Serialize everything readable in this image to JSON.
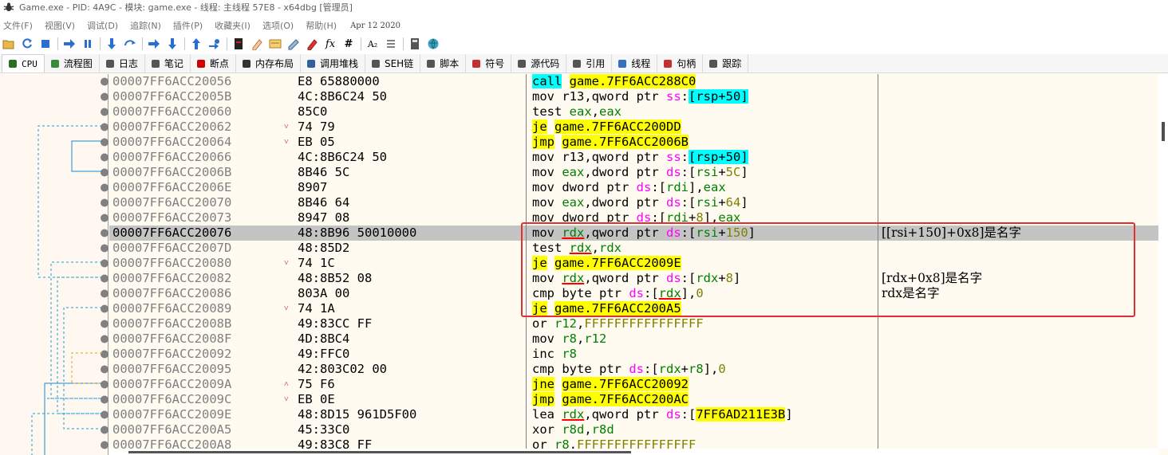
{
  "window": {
    "title": "Game.exe - PID: 4A9C - 模块: game.exe - 线程: 主线程 57E8 - x64dbg [管理员]"
  },
  "menu": {
    "items": [
      "文件(F)",
      "视图(V)",
      "调试(D)",
      "追踪(N)",
      "插件(P)",
      "收藏夹(I)",
      "选项(O)",
      "帮助(H)"
    ],
    "date": "Apr 12 2020"
  },
  "toolbar": {
    "buttons": [
      "open-icon",
      "restart-icon",
      "stop-icon",
      "run-icon",
      "pause-icon",
      "step-into-icon",
      "step-over-icon",
      "trace-into-icon",
      "trace-over-icon",
      "execute-till-return-icon",
      "run-to-user-code-icon",
      "patch-icon",
      "comment-icon",
      "label-icon",
      "bookmark-icon",
      "function-icon",
      "analyze-icon",
      "calculator-icon",
      "font-icon",
      "list-icon",
      "memory-map-icon",
      "help-icon"
    ],
    "text_fx": "fx",
    "text_hash": "#",
    "text_az": "A₂"
  },
  "tabs": [
    {
      "label": "CPU",
      "icon": "cpu-icon",
      "color": "#2a6c2a"
    },
    {
      "label": "流程图",
      "icon": "graph-icon",
      "color": "#3a8a3a"
    },
    {
      "label": "日志",
      "icon": "log-icon",
      "color": "#555555"
    },
    {
      "label": "笔记",
      "icon": "notes-icon",
      "color": "#555555"
    },
    {
      "label": "断点",
      "icon": "breakpoint-icon",
      "color": "#d00000"
    },
    {
      "label": "内存布局",
      "icon": "memory-map-icon",
      "color": "#333333"
    },
    {
      "label": "调用堆栈",
      "icon": "call-stack-icon",
      "color": "#3060a0"
    },
    {
      "label": "SEH链",
      "icon": "seh-icon",
      "color": "#555555"
    },
    {
      "label": "脚本",
      "icon": "script-icon",
      "color": "#555555"
    },
    {
      "label": "符号",
      "icon": "symbols-icon",
      "color": "#c03030"
    },
    {
      "label": "源代码",
      "icon": "source-icon",
      "color": "#555555"
    },
    {
      "label": "引用",
      "icon": "references-icon",
      "color": "#555555"
    },
    {
      "label": "线程",
      "icon": "threads-icon",
      "color": "#3070c0"
    },
    {
      "label": "句柄",
      "icon": "handles-icon",
      "color": "#c03030"
    },
    {
      "label": "跟踪",
      "icon": "trace-icon",
      "color": "#555555"
    }
  ],
  "disasm": {
    "selected_index": 10,
    "rows": [
      {
        "addr": "00007FF6ACC20056",
        "jmp": "",
        "bytes": "E8 65880000",
        "instr": [
          [
            "call",
            "hl-c"
          ],
          [
            " ",
            ""
          ],
          [
            "game.7FF6ACC288C0",
            "hl-y"
          ]
        ],
        "comment": ""
      },
      {
        "addr": "00007FF6ACC2005B",
        "jmp": "",
        "bytes": "4C:8B6C24 50",
        "instr": [
          [
            "mov r13,qword ptr ",
            ""
          ],
          [
            "ss",
            "c-seg"
          ],
          [
            ":",
            ""
          ],
          [
            "[rsp+50]",
            "k-cyan"
          ]
        ],
        "comment": ""
      },
      {
        "addr": "00007FF6ACC20060",
        "jmp": "",
        "bytes": "85C0",
        "instr": [
          [
            "test ",
            ""
          ],
          [
            "eax",
            "c-reg"
          ],
          [
            ",",
            ""
          ],
          [
            "eax",
            "c-reg"
          ]
        ],
        "comment": ""
      },
      {
        "addr": "00007FF6ACC20062",
        "jmp": "˅",
        "bytes": "74 79",
        "instr": [
          [
            "je",
            "hl-y"
          ],
          [
            " ",
            ""
          ],
          [
            "game.7FF6ACC200DD",
            "hl-y"
          ]
        ],
        "comment": ""
      },
      {
        "addr": "00007FF6ACC20064",
        "jmp": "˅",
        "bytes": "EB 05",
        "instr": [
          [
            "jmp",
            "hl-y"
          ],
          [
            " ",
            ""
          ],
          [
            "game.7FF6ACC2006B",
            "hl-y"
          ]
        ],
        "comment": ""
      },
      {
        "addr": "00007FF6ACC20066",
        "jmp": "",
        "bytes": "4C:8B6C24 50",
        "instr": [
          [
            "mov r13,qword ptr ",
            ""
          ],
          [
            "ss",
            "c-seg"
          ],
          [
            ":",
            ""
          ],
          [
            "[rsp+50]",
            "k-cyan"
          ]
        ],
        "comment": ""
      },
      {
        "addr": "00007FF6ACC2006B",
        "jmp": "",
        "bytes": "8B46 5C",
        "instr": [
          [
            "mov ",
            ""
          ],
          [
            "eax",
            "c-reg"
          ],
          [
            ",dword ptr ",
            ""
          ],
          [
            "ds",
            "c-seg"
          ],
          [
            ":[",
            ""
          ],
          [
            "rsi",
            "c-reg"
          ],
          [
            "+",
            ""
          ],
          [
            "5C",
            "c-num"
          ],
          [
            "]",
            ""
          ]
        ],
        "comment": ""
      },
      {
        "addr": "00007FF6ACC2006E",
        "jmp": "",
        "bytes": "8907",
        "instr": [
          [
            "mov dword ptr ",
            ""
          ],
          [
            "ds",
            "c-seg"
          ],
          [
            ":[",
            ""
          ],
          [
            "rdi",
            "c-reg"
          ],
          [
            "],",
            ""
          ],
          [
            "eax",
            "c-reg"
          ]
        ],
        "comment": ""
      },
      {
        "addr": "00007FF6ACC20070",
        "jmp": "",
        "bytes": "8B46 64",
        "instr": [
          [
            "mov ",
            ""
          ],
          [
            "eax",
            "c-reg"
          ],
          [
            ",dword ptr ",
            ""
          ],
          [
            "ds",
            "c-seg"
          ],
          [
            ":[",
            ""
          ],
          [
            "rsi",
            "c-reg"
          ],
          [
            "+",
            ""
          ],
          [
            "64",
            "c-num"
          ],
          [
            "]",
            ""
          ]
        ],
        "comment": ""
      },
      {
        "addr": "00007FF6ACC20073",
        "jmp": "",
        "bytes": "8947 08",
        "instr": [
          [
            "mov dword ptr ",
            ""
          ],
          [
            "ds",
            "c-seg"
          ],
          [
            ":[",
            ""
          ],
          [
            "rdi",
            "c-reg"
          ],
          [
            "+",
            ""
          ],
          [
            "8",
            "c-num"
          ],
          [
            "],",
            ""
          ],
          [
            "eax",
            "c-reg"
          ]
        ],
        "comment": ""
      },
      {
        "addr": "00007FF6ACC20076",
        "jmp": "",
        "bytes": "48:8B96 50010000",
        "instr": [
          [
            "mov ",
            ""
          ],
          [
            "rdx",
            "c-reg u-red"
          ],
          [
            ",qword ptr ",
            ""
          ],
          [
            "ds",
            "c-seg"
          ],
          [
            ":[",
            ""
          ],
          [
            "rsi",
            "c-reg"
          ],
          [
            "+",
            ""
          ],
          [
            "150",
            "c-num"
          ],
          [
            "]",
            ""
          ]
        ],
        "comment": "[[rsi+150]+0x8]是名字"
      },
      {
        "addr": "00007FF6ACC2007D",
        "jmp": "",
        "bytes": "48:85D2",
        "instr": [
          [
            "test ",
            ""
          ],
          [
            "rdx",
            "c-reg u-red"
          ],
          [
            ",",
            ""
          ],
          [
            "rdx",
            "c-reg"
          ]
        ],
        "comment": ""
      },
      {
        "addr": "00007FF6ACC20080",
        "jmp": "˅",
        "bytes": "74 1C",
        "instr": [
          [
            "je",
            "hl-y"
          ],
          [
            " ",
            ""
          ],
          [
            "game.7FF6ACC2009E",
            "hl-y"
          ]
        ],
        "comment": ""
      },
      {
        "addr": "00007FF6ACC20082",
        "jmp": "",
        "bytes": "48:8B52 08",
        "instr": [
          [
            "mov ",
            ""
          ],
          [
            "rdx",
            "c-reg u-red"
          ],
          [
            ",qword ptr ",
            ""
          ],
          [
            "ds",
            "c-seg"
          ],
          [
            ":[",
            ""
          ],
          [
            "rdx",
            "c-reg"
          ],
          [
            "+",
            ""
          ],
          [
            "8",
            "c-num"
          ],
          [
            "]",
            ""
          ]
        ],
        "comment": "[rdx+0x8]是名字"
      },
      {
        "addr": "00007FF6ACC20086",
        "jmp": "",
        "bytes": "803A 00",
        "instr": [
          [
            "cmp byte ptr ",
            ""
          ],
          [
            "ds",
            "c-seg"
          ],
          [
            ":[",
            ""
          ],
          [
            "rdx",
            "c-reg u-red"
          ],
          [
            "],",
            ""
          ],
          [
            "0",
            "c-num"
          ]
        ],
        "comment": "rdx是名字"
      },
      {
        "addr": "00007FF6ACC20089",
        "jmp": "˅",
        "bytes": "74 1A",
        "instr": [
          [
            "je",
            "hl-y"
          ],
          [
            " ",
            ""
          ],
          [
            "game.7FF6ACC200A5",
            "hl-y"
          ]
        ],
        "comment": ""
      },
      {
        "addr": "00007FF6ACC2008B",
        "jmp": "",
        "bytes": "49:83CC FF",
        "instr": [
          [
            "or ",
            ""
          ],
          [
            "r12",
            "c-reg"
          ],
          [
            ",",
            ""
          ],
          [
            "FFFFFFFFFFFFFFFF",
            "c-num"
          ]
        ],
        "comment": ""
      },
      {
        "addr": "00007FF6ACC2008F",
        "jmp": "",
        "bytes": "4D:8BC4",
        "instr": [
          [
            "mov ",
            ""
          ],
          [
            "r8",
            "c-reg"
          ],
          [
            ",",
            ""
          ],
          [
            "r12",
            "c-reg"
          ]
        ],
        "comment": ""
      },
      {
        "addr": "00007FF6ACC20092",
        "jmp": "",
        "bytes": "49:FFC0",
        "instr": [
          [
            "inc ",
            ""
          ],
          [
            "r8",
            "c-reg"
          ]
        ],
        "comment": ""
      },
      {
        "addr": "00007FF6ACC20095",
        "jmp": "",
        "bytes": "42:803C02 00",
        "instr": [
          [
            "cmp byte ptr ",
            ""
          ],
          [
            "ds",
            "c-seg"
          ],
          [
            ":[",
            ""
          ],
          [
            "rdx",
            "c-reg"
          ],
          [
            "+",
            ""
          ],
          [
            "r8",
            "c-reg"
          ],
          [
            "],",
            ""
          ],
          [
            "0",
            "c-num"
          ]
        ],
        "comment": ""
      },
      {
        "addr": "00007FF6ACC2009A",
        "jmp": "˄",
        "bytes": "75 F6",
        "instr": [
          [
            "jne",
            "hl-y"
          ],
          [
            " ",
            ""
          ],
          [
            "game.7FF6ACC20092",
            "hl-y"
          ]
        ],
        "comment": ""
      },
      {
        "addr": "00007FF6ACC2009C",
        "jmp": "˅",
        "bytes": "EB 0E",
        "instr": [
          [
            "jmp",
            "hl-y"
          ],
          [
            " ",
            ""
          ],
          [
            "game.7FF6ACC200AC",
            "hl-y"
          ]
        ],
        "comment": ""
      },
      {
        "addr": "00007FF6ACC2009E",
        "jmp": "",
        "bytes": "48:8D15 961D5F00",
        "instr": [
          [
            "lea ",
            ""
          ],
          [
            "rdx",
            "c-reg u-red"
          ],
          [
            ",qword ptr ",
            ""
          ],
          [
            "ds",
            "c-seg"
          ],
          [
            ":[",
            ""
          ],
          [
            "7FF6AD211E3B",
            "hl-y"
          ],
          [
            "]",
            ""
          ]
        ],
        "comment": ""
      },
      {
        "addr": "00007FF6ACC200A5",
        "jmp": "",
        "bytes": "45:33C0",
        "instr": [
          [
            "xor ",
            ""
          ],
          [
            "r8d",
            "c-reg"
          ],
          [
            ",",
            ""
          ],
          [
            "r8d",
            "c-reg"
          ]
        ],
        "comment": ""
      },
      {
        "addr": "00007FF6ACC200A8",
        "jmp": "",
        "bytes": "49:83C8 FF",
        "instr": [
          [
            "or ",
            ""
          ],
          [
            "r8",
            "c-reg"
          ],
          [
            ",",
            ""
          ],
          [
            "FFFFFFFFFFFFFFFF",
            "c-num"
          ]
        ],
        "comment": ""
      }
    ]
  },
  "colors": {
    "highlight_yellow": "#ffff00",
    "highlight_cyan": "#00ffff",
    "selection_row": "#c4c4c4",
    "annotation_box": "#e03030"
  }
}
